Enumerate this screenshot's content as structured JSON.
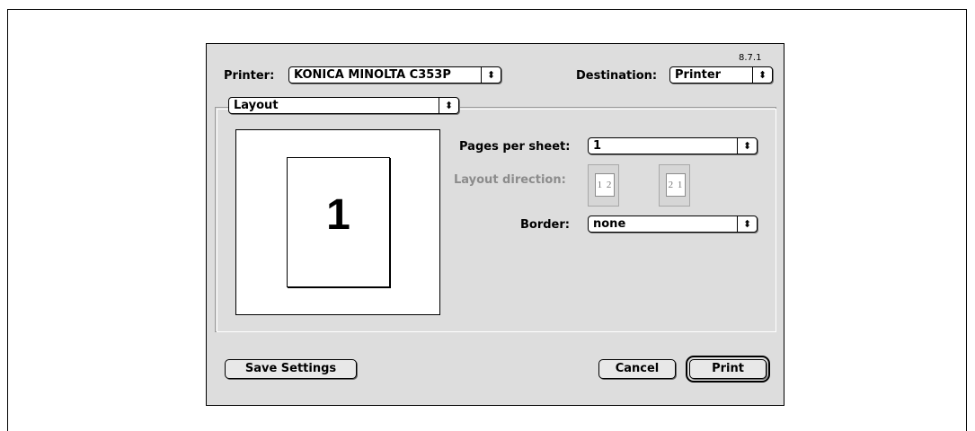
{
  "dialog": {
    "version": "8.7.1",
    "printer_label": "Printer:",
    "printer_value": "KONICA MINOLTA C353P",
    "destination_label": "Destination:",
    "destination_value": "Printer",
    "panel_value": "Layout"
  },
  "layout": {
    "preview_number": "1",
    "pages_per_sheet_label": "Pages per sheet:",
    "pages_per_sheet_value": "1",
    "direction_label": "Layout direction:",
    "direction_options": [
      "1 2",
      "2 1"
    ],
    "border_label": "Border:",
    "border_value": "none"
  },
  "buttons": {
    "save": "Save Settings",
    "cancel": "Cancel",
    "print": "Print"
  }
}
